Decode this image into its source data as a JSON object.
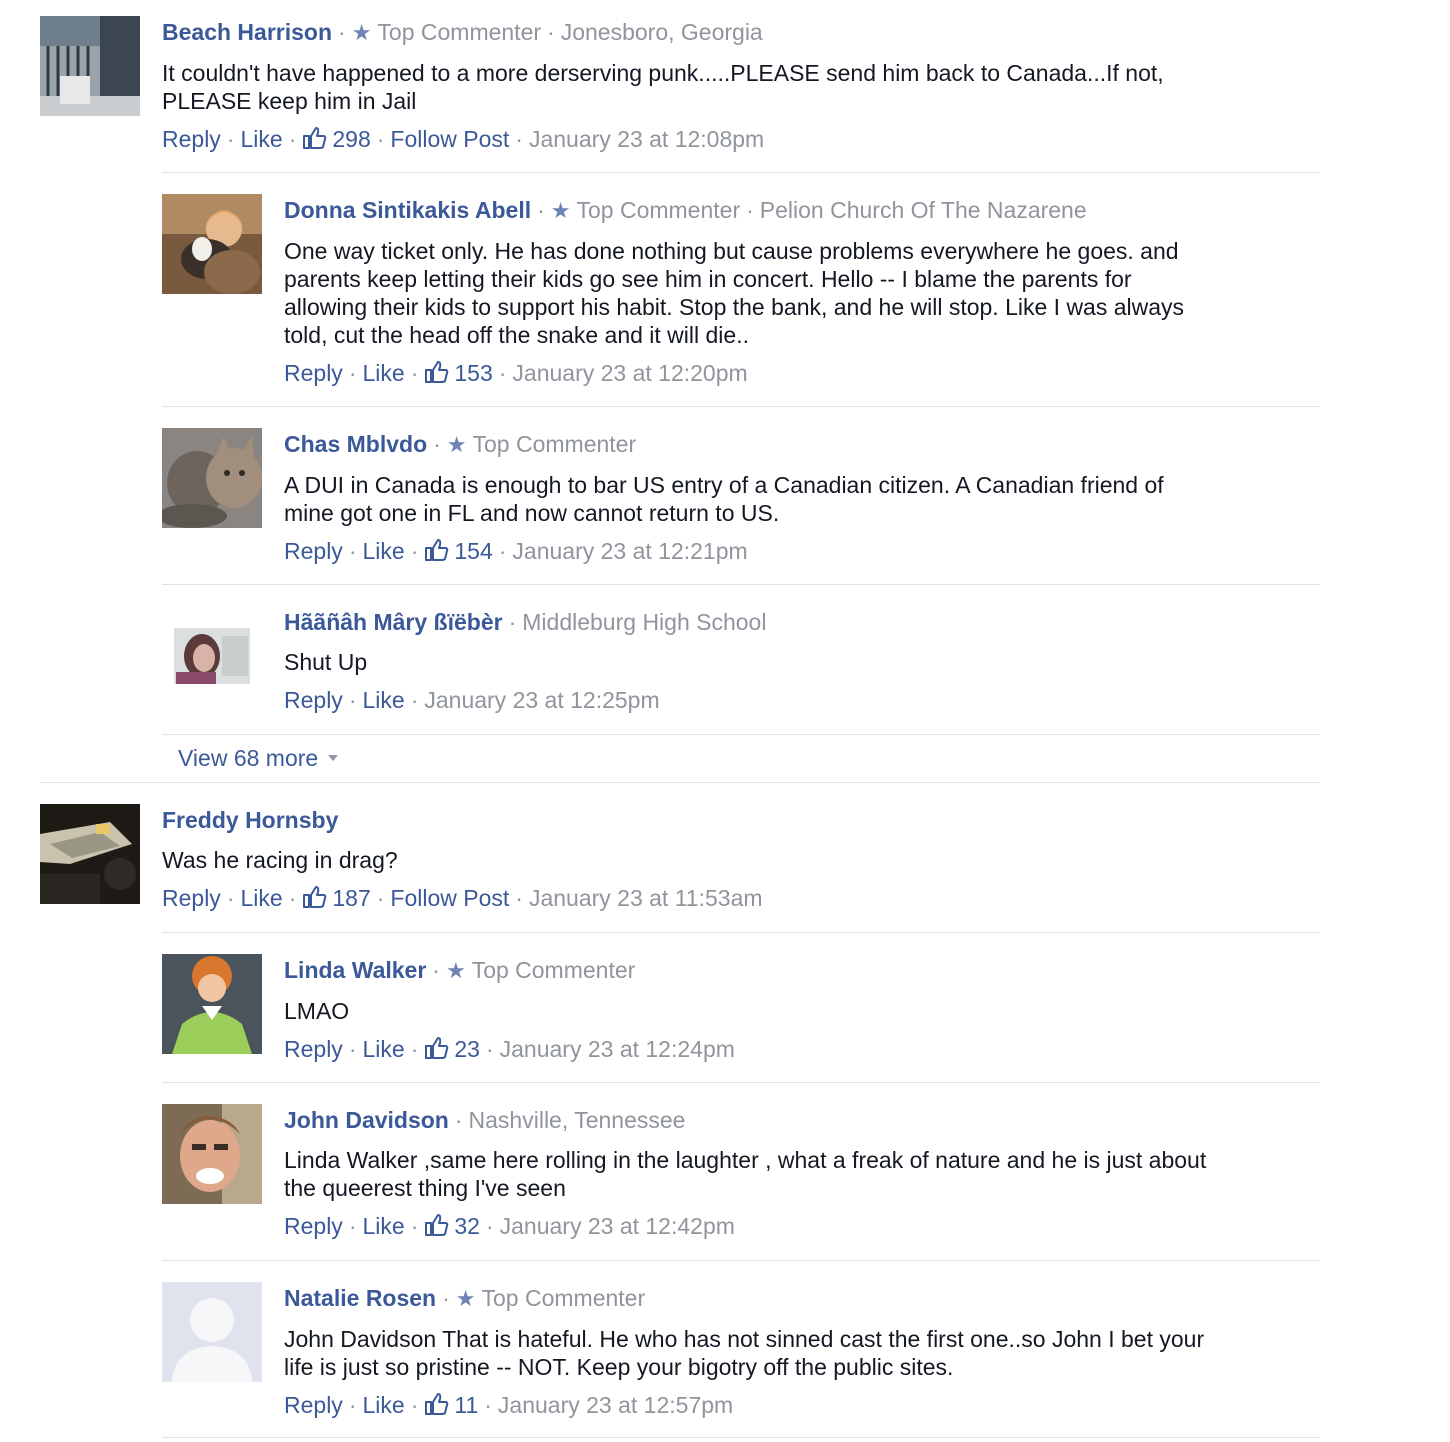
{
  "colors": {
    "name": "#3b5998",
    "meta": "#90949c",
    "text": "#141823",
    "divider": "#e1e2e5"
  },
  "labels": {
    "reply": "Reply",
    "like": "Like",
    "follow": "Follow Post",
    "sep": "·",
    "top_commenter": "Top Commenter"
  },
  "comments": [
    {
      "name": "Beach Harrison",
      "top": true,
      "meta": "Jonesboro, Georgia",
      "lines": [
        "It couldn't have happened to a more derserving punk.....PLEASE send him back to Canada...If not,",
        "PLEASE keep him in Jail"
      ],
      "likes": "298",
      "follow": true,
      "time": "January 23 at 12:08pm",
      "avatar_icon": "balcony-photo-icon"
    },
    {
      "name": "Donna Sintikakis Abell",
      "top": true,
      "meta": "Pelion Church Of The Nazarene",
      "lines": [
        "One way ticket only. He has done nothing but cause problems everywhere he goes. and",
        "parents keep letting their kids go see him in concert. Hello -- I blame the parents for",
        "allowing their kids to support his habit. Stop the bank, and he will stop. Like I was always",
        "told, cut the head off the snake and it will die.."
      ],
      "likes": "153",
      "time": "January 23 at 12:20pm",
      "avatar_icon": "woman-with-dog-photo-icon"
    },
    {
      "name": "Chas Mblvdo",
      "top": true,
      "meta": "",
      "lines": [
        "A DUI in Canada is enough to bar US entry of a Canadian citizen. A Canadian friend of",
        "mine got one in FL and now cannot return to US."
      ],
      "likes": "154",
      "time": "January 23 at 12:21pm",
      "avatar_icon": "cats-photo-icon"
    },
    {
      "name": "Hããñâh Mâry ßïëbèr",
      "top": false,
      "meta": "Middleburg High School",
      "lines": [
        "Shut Up"
      ],
      "likes": "",
      "time": "January 23 at 12:25pm",
      "avatar_icon": "girl-photo-icon"
    },
    {
      "name": "Freddy Hornsby",
      "top": false,
      "meta": "",
      "lines": [
        "Was he racing in drag?"
      ],
      "likes": "187",
      "follow": true,
      "time": "January 23 at 11:53am",
      "avatar_icon": "racing-car-photo-icon"
    },
    {
      "name": "Linda Walker",
      "top": true,
      "meta": "",
      "lines": [
        "LMAO"
      ],
      "likes": "23",
      "time": "January 23 at 12:24pm",
      "avatar_icon": "redhead-woman-photo-icon"
    },
    {
      "name": "John Davidson",
      "top": false,
      "meta": "Nashville, Tennessee",
      "lines": [
        "Linda Walker ,same here rolling in the laughter , what a freak of nature and he is just about",
        "the queerest thing I've seen"
      ],
      "likes": "32",
      "time": "January 23 at 12:42pm",
      "avatar_icon": "man-laughing-photo-icon"
    },
    {
      "name": "Natalie Rosen",
      "top": true,
      "meta": "",
      "lines": [
        "John Davidson That is hateful. He who has not sinned cast the first one..so John I bet your",
        "life is just so pristine -- NOT. Keep your bigotry off the public sites."
      ],
      "likes": "11",
      "time": "January 23 at 12:57pm",
      "avatar_icon": "default-silhouette-icon"
    }
  ],
  "view_more": "View 68 more"
}
